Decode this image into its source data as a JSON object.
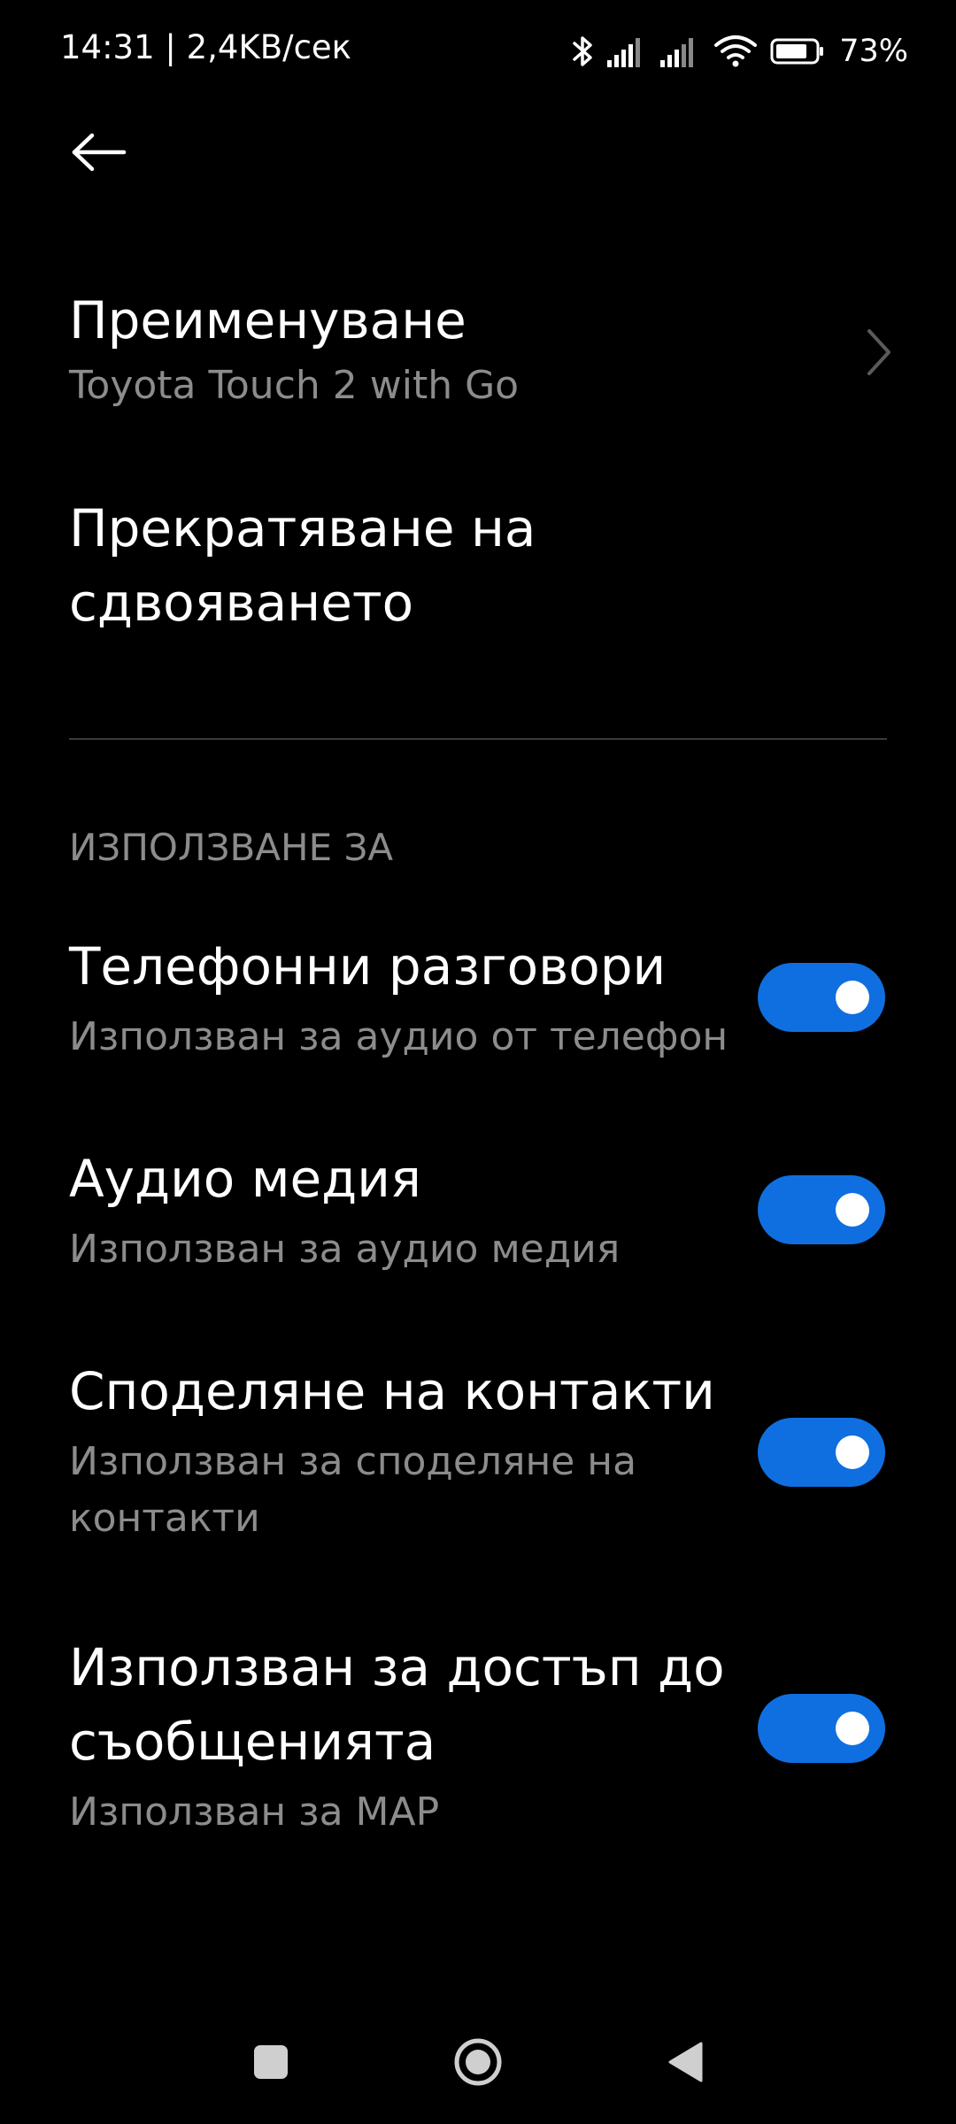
{
  "status_bar": {
    "time_speed": "14:31 | 2,4KB/сек",
    "battery_percent": "73%",
    "icons": [
      "bluetooth-icon",
      "signal-icon",
      "signal-icon",
      "wifi-icon",
      "battery-icon"
    ]
  },
  "header": {
    "back_icon": "arrow-left-icon"
  },
  "rename": {
    "title": "Преименуване",
    "subtitle": "Toyota Touch 2 with Go"
  },
  "unpair": {
    "title_line1": "Прекратяване на",
    "title_line2": "сдвояването"
  },
  "section": {
    "header": "ИЗПОЛЗВАНЕ ЗА"
  },
  "toggles": [
    {
      "title": "Телефонни разговори",
      "subtitle": "Използван за аудио от телефон",
      "enabled": true
    },
    {
      "title": "Аудио медия",
      "subtitle": "Използван за аудио медия",
      "enabled": true
    },
    {
      "title": "Споделяне на контакти",
      "subtitle_line1": "Използван за споделяне на",
      "subtitle_line2": "контакти",
      "enabled": true
    },
    {
      "title_line1": "Използван за достъп до",
      "title_line2": "съобщенията",
      "subtitle": "Използван за MAP",
      "enabled": true
    }
  ],
  "colors": {
    "background": "#000000",
    "primary_text": "#ffffff",
    "secondary_text": "#8c8c8c",
    "toggle_on": "#0f6fe0",
    "divider": "#3a3a3a"
  },
  "nav_bar": {
    "recents_icon": "square-icon",
    "home_icon": "circle-icon",
    "back_icon": "triangle-back-icon"
  }
}
